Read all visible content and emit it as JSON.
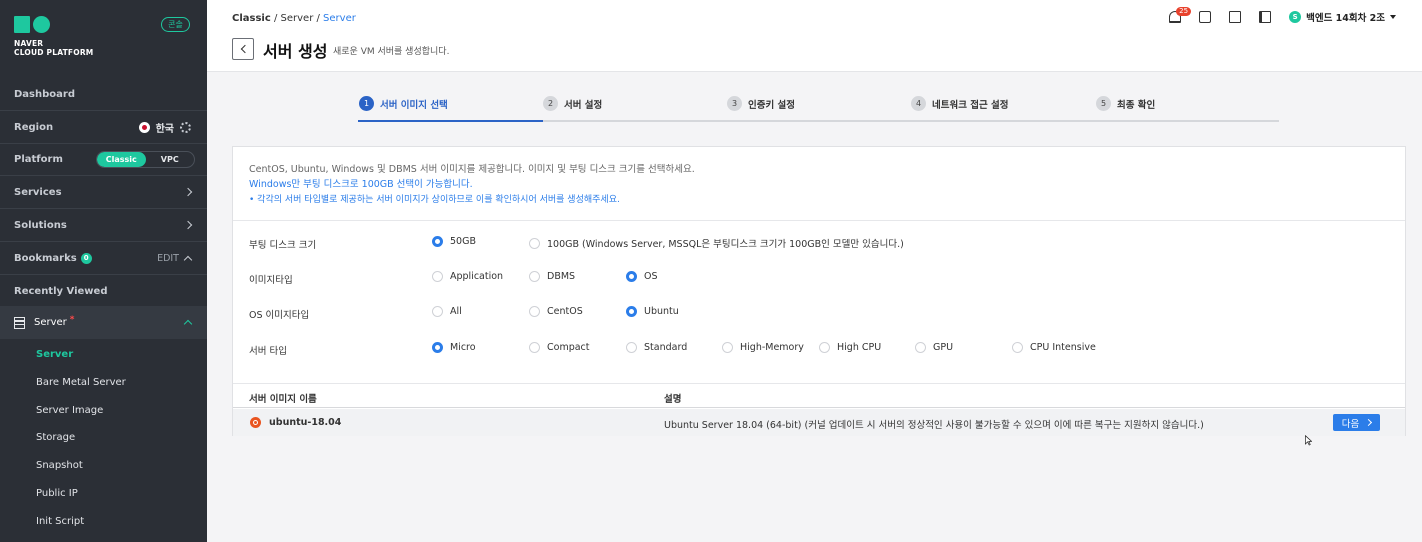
{
  "sidebar": {
    "logo_line1": "NAVER",
    "logo_line2": "CLOUD PLATFORM",
    "console_badge": "콘솔",
    "dashboard": "Dashboard",
    "region_label": "Region",
    "region_value": "한국",
    "platform_label": "Platform",
    "platform_options": [
      "Classic",
      "VPC"
    ],
    "platform_selected": "Classic",
    "services": "Services",
    "solutions": "Solutions",
    "bookmarks": "Bookmarks",
    "bookmarks_count": "0",
    "bookmarks_edit": "EDIT",
    "recently_viewed": "Recently Viewed",
    "server_group": "Server",
    "server_marker": "*",
    "sub_items": [
      "Server",
      "Bare Metal Server",
      "Server Image",
      "Storage",
      "Snapshot",
      "Public IP",
      "Init Script"
    ],
    "active_sub_item": "Server"
  },
  "header": {
    "breadcrumb": [
      "Classic",
      "Server",
      "Server"
    ],
    "title": "서버 생성",
    "subtitle": "새로운 VM 서버를 생성합니다.",
    "notification_count": "25",
    "user_initial": "S",
    "user_name": "백엔드 14회차 2조"
  },
  "steps": [
    {
      "num": "1",
      "label": "서버 이미지 선택",
      "active": true
    },
    {
      "num": "2",
      "label": "서버 설정",
      "active": false
    },
    {
      "num": "3",
      "label": "인증키 설정",
      "active": false
    },
    {
      "num": "4",
      "label": "네트워크 접근 설정",
      "active": false
    },
    {
      "num": "5",
      "label": "최종 확인",
      "active": false
    }
  ],
  "info": {
    "line1": "CentOS, Ubuntu, Windows 및 DBMS 서버 이미지를 제공합니다. 이미지 및 부팅 디스크 크기를 선택하세요.",
    "line2": "Windows만 부팅 디스크로 100GB 선택이 가능합니다.",
    "line3": "각각의 서버 타입별로 제공하는 서버 이미지가 상이하므로 이를 확인하시어 서버를 생성해주세요."
  },
  "options": {
    "boot_disk": {
      "label": "부팅 디스크 크기",
      "choices": [
        "50GB",
        "100GB (Windows Server, MSSQL은 부팅디스크 크기가 100GB인 모델만 있습니다.)"
      ],
      "selected": "50GB"
    },
    "image_type": {
      "label": "이미지타입",
      "choices": [
        "Application",
        "DBMS",
        "OS"
      ],
      "selected": "OS"
    },
    "os_image_type": {
      "label": "OS 이미지타입",
      "choices": [
        "All",
        "CentOS",
        "Ubuntu"
      ],
      "selected": "Ubuntu"
    },
    "server_type": {
      "label": "서버 타입",
      "choices": [
        "Micro",
        "Compact",
        "Standard",
        "High-Memory",
        "High CPU",
        "GPU",
        "CPU Intensive"
      ],
      "selected": "Micro"
    }
  },
  "table": {
    "col_name": "서버 이미지 이름",
    "col_desc": "설명",
    "rows": [
      {
        "name": "ubuntu-18.04",
        "desc": "Ubuntu Server 18.04 (64-bit) (커널 업데이트 시 서버의 정상적인 사용이 불가능할 수 있으며 이에 따른 복구는 지원하지 않습니다.)",
        "button": "다음"
      }
    ]
  },
  "colors": {
    "accent_green": "#1ec89f",
    "accent_blue": "#2b7de9",
    "step_blue": "#2b63c6",
    "sidebar_bg": "#2b2f36"
  }
}
